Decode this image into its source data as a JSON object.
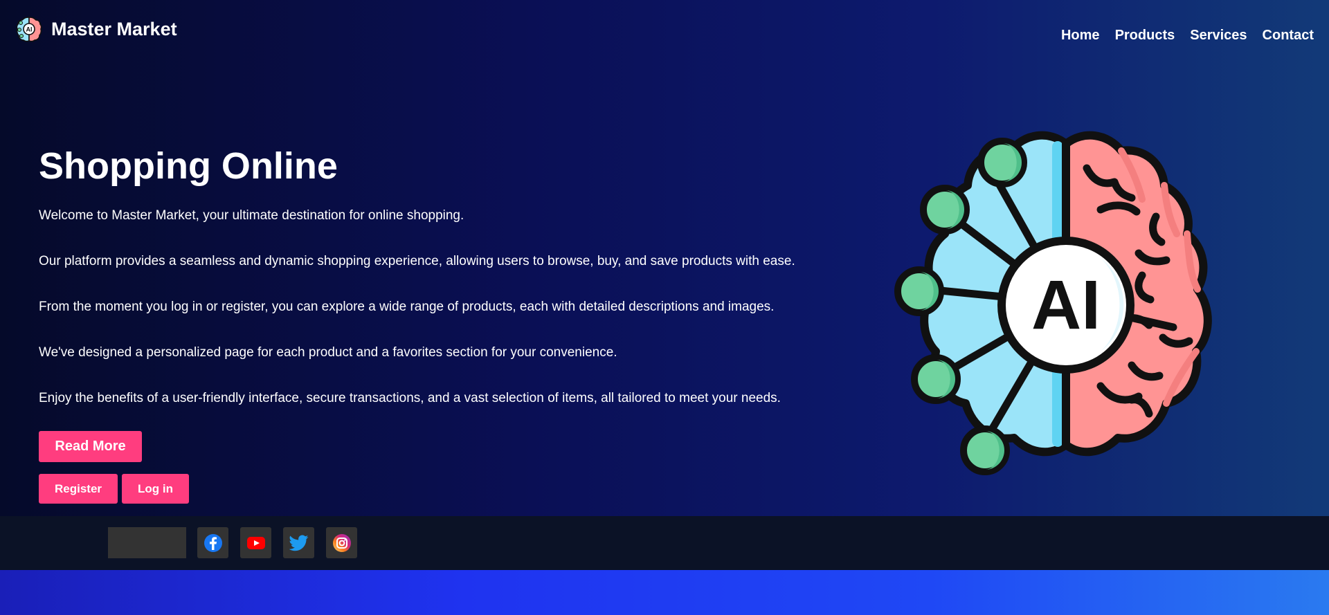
{
  "brand": {
    "name": "Master Market",
    "logo_icon": "ai-brain-logo-icon",
    "logo_text": "AI"
  },
  "nav": {
    "items": [
      {
        "label": "Home"
      },
      {
        "label": "Products"
      },
      {
        "label": "Services"
      },
      {
        "label": "Contact"
      }
    ]
  },
  "hero": {
    "title": "Shopping Online",
    "paragraphs": [
      "Welcome to Master Market, your ultimate destination for online shopping.",
      "Our platform provides a seamless and dynamic shopping experience, allowing users to browse, buy, and save products with ease.",
      "From the moment you log in or register, you can explore a wide range of products, each with detailed descriptions and images.",
      "We've designed a personalized page for each product and a favorites section for your convenience.",
      "Enjoy the benefits of a user-friendly interface, secure transactions, and a vast selection of items, all tailored to meet your needs."
    ],
    "read_more_label": "Read More",
    "register_label": "Register",
    "login_label": "Log in",
    "illustration": "ai-brain-icon",
    "illustration_text": "AI"
  },
  "footer": {
    "social": [
      {
        "icon": "facebook-icon"
      },
      {
        "icon": "youtube-icon"
      },
      {
        "icon": "twitter-icon"
      },
      {
        "icon": "instagram-icon"
      }
    ]
  },
  "colors": {
    "accent": "#ff3d7f",
    "hero_dark": "#050a2a",
    "hero_mid": "#0a0f55",
    "footer_bg": "#0b1226",
    "brain_left": "#9be4f9",
    "brain_right": "#ff9494",
    "node": "#6fd39f"
  }
}
